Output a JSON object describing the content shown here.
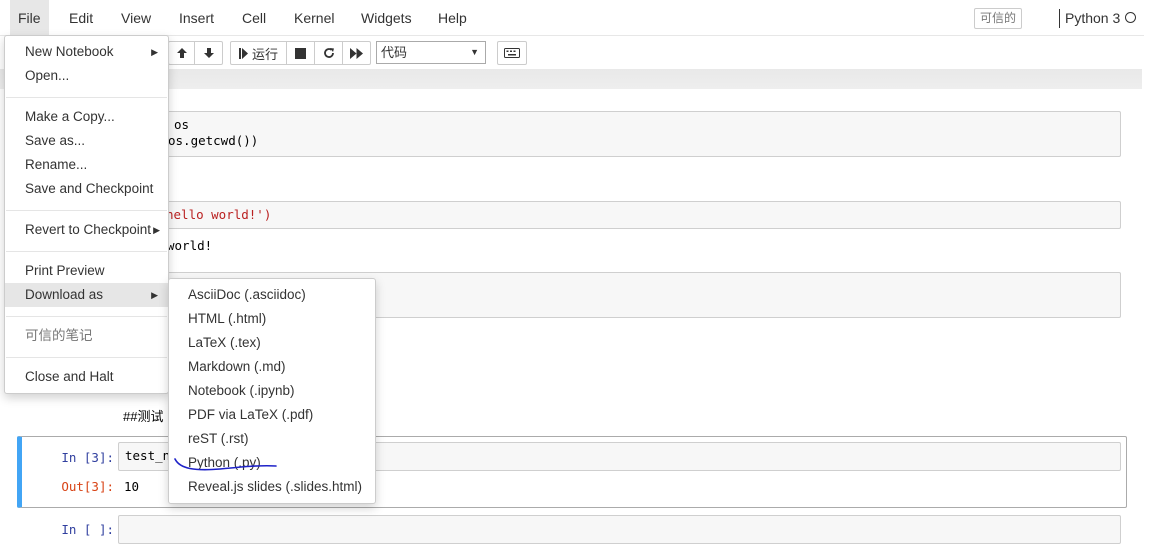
{
  "menubar": {
    "items": [
      "File",
      "Edit",
      "View",
      "Insert",
      "Cell",
      "Kernel",
      "Widgets",
      "Help"
    ],
    "trusted": "可信的",
    "kernel": "Python 3"
  },
  "toolbar": {
    "run_label": "运行",
    "cell_type": "代码"
  },
  "file_menu": {
    "new_notebook": "New Notebook",
    "open": "Open...",
    "make_copy": "Make a Copy...",
    "save_as": "Save as...",
    "rename": "Rename...",
    "save_checkpoint": "Save and Checkpoint",
    "revert": "Revert to Checkpoint",
    "print_preview": "Print Preview",
    "download_as": "Download as",
    "trusted_notebook": "可信的笔记",
    "close_halt": "Close and Halt"
  },
  "download_menu": {
    "items": [
      "AsciiDoc (.asciidoc)",
      "HTML (.html)",
      "LaTeX (.tex)",
      "Markdown (.md)",
      "Notebook (.ipynb)",
      "PDF via LaTeX (.pdf)",
      "reST (.rst)",
      "Python (.py)",
      "Reveal.js slides (.slides.html)"
    ],
    "annotation_color": "#1e22c8"
  },
  "cells": {
    "c1_line1": "os",
    "c1_line2": "os.getcwd())",
    "c2_line": "hello world!')",
    "c2_out": "world!",
    "md_text": "##测试",
    "c3_in_prompt": "In  [3]:",
    "c3_code": "test_nu",
    "c3_out_prompt": "Out[3]:",
    "c3_out": "10",
    "c4_in_prompt": "In  [ ]:"
  }
}
